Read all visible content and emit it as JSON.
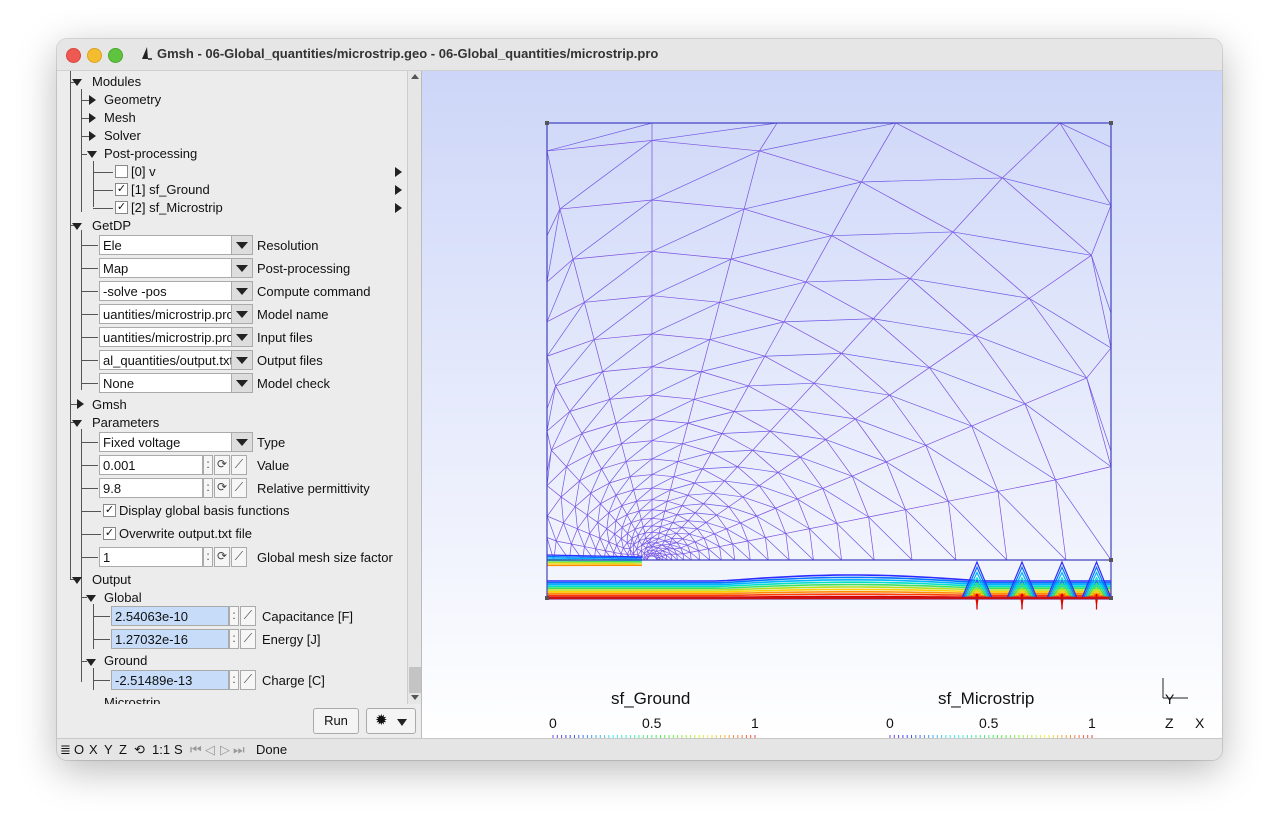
{
  "window": {
    "title": "Gmsh - 06-Global_quantities/microstrip.geo - 06-Global_quantities/microstrip.pro",
    "colors": {
      "close": "#ee5a52",
      "minimize": "#f4bd30",
      "zoom": "#5fc33f"
    }
  },
  "tree": {
    "modules": "Modules",
    "geometry": "Geometry",
    "mesh": "Mesh",
    "solver": "Solver",
    "post_processing": "Post-processing",
    "views": [
      {
        "label": "[0] v",
        "checked": false
      },
      {
        "label": "[1] sf_Ground",
        "checked": true
      },
      {
        "label": "[2] sf_Microstrip",
        "checked": true
      }
    ],
    "getdp": "GetDP",
    "getdp_rows": [
      {
        "value": "Ele",
        "label": "Resolution"
      },
      {
        "value": "Map",
        "label": "Post-processing"
      },
      {
        "value": "-solve -pos",
        "label": "Compute command"
      },
      {
        "value": "uantities/microstrip.pro",
        "label": "Model name"
      },
      {
        "value": "uantities/microstrip.pro",
        "label": "Input files"
      },
      {
        "value": "al_quantities/output.txt",
        "label": "Output files"
      },
      {
        "value": "None",
        "label": "Model check"
      }
    ],
    "gmsh": "Gmsh",
    "parameters": "Parameters",
    "type_value": "Fixed voltage",
    "type_label": "Type",
    "value_value": "0.001",
    "value_label": "Value",
    "perm_value": "9.8",
    "perm_label": "Relative permittivity",
    "display_basis": "Display global basis functions",
    "overwrite": "Overwrite output.txt file",
    "meshsize_value": "1",
    "meshsize_label": "Global mesh size factor",
    "output": "Output",
    "global": "Global",
    "capacitance_value": "2.54063e-10",
    "capacitance_label": "Capacitance [F]",
    "energy_value": "1.27032e-16",
    "energy_label": "Energy [J]",
    "ground": "Ground",
    "charge_value": "-2.51489e-13",
    "charge_label": "Charge [C]",
    "microstrip_partial": "Microstrip"
  },
  "buttons": {
    "run": "Run",
    "gear": "✹"
  },
  "colorbars": [
    {
      "name": "sf_Ground",
      "ticks": [
        "0",
        "0.5",
        "1"
      ]
    },
    {
      "name": "sf_Microstrip",
      "ticks": [
        "0",
        "0.5",
        "1"
      ]
    }
  ],
  "axes": {
    "y": "Y",
    "z": "Z",
    "x": "X"
  },
  "status": {
    "ortho": "O",
    "x": "X",
    "y": "Y",
    "z": "Z",
    "scale": "1:1",
    "s": "S",
    "message": "Done"
  }
}
